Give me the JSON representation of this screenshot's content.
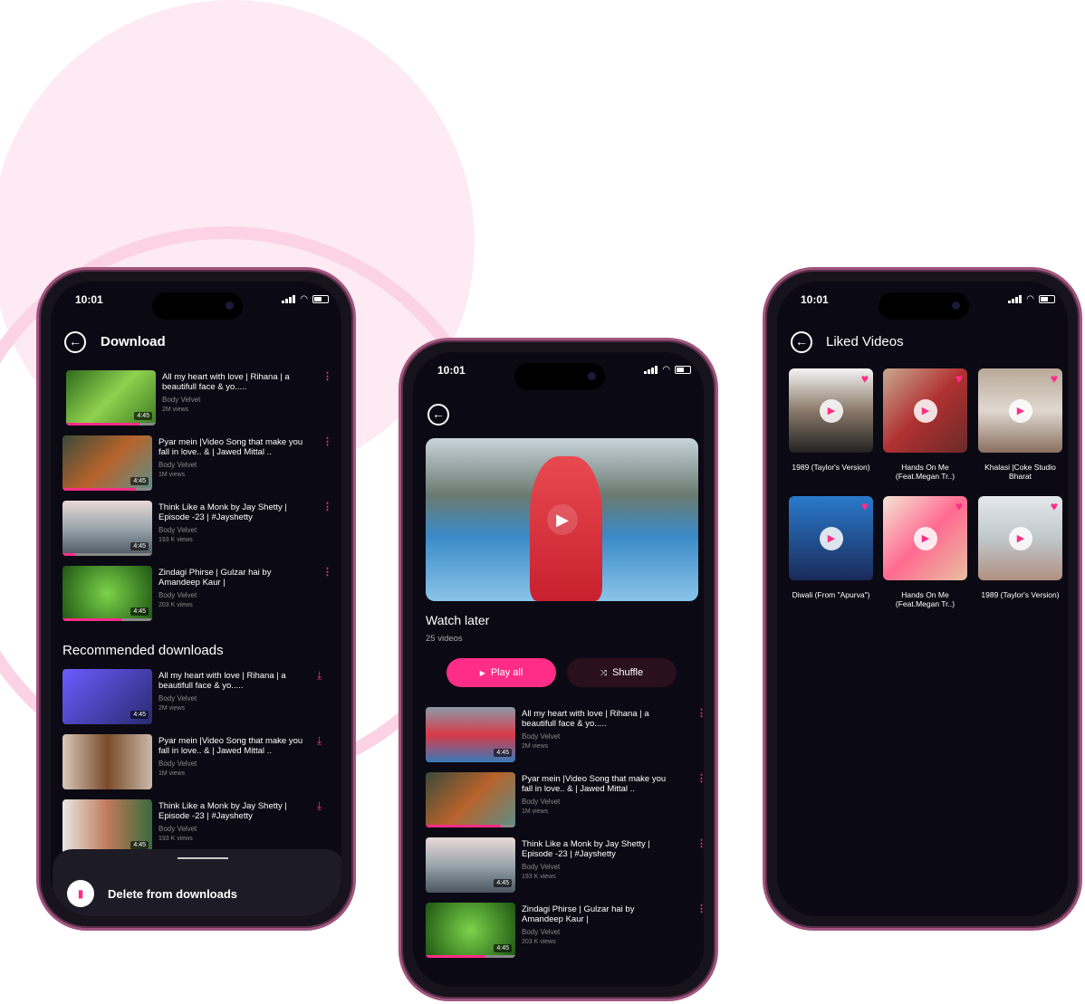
{
  "status": {
    "time": "10:01"
  },
  "colors": {
    "accent": "#ff2d87",
    "screen_bg": "#0b0a14",
    "bg_circle": "#fdeaf2"
  },
  "download": {
    "title": "Download",
    "items": [
      {
        "title": "All my heart with love | Rihana | a beautifull face & yo.....",
        "channel": "Body Velvet",
        "views": "2M views",
        "duration": "4:45",
        "progress": 0.82,
        "thumb": "linear-gradient(135deg,#2f6b1c,#8fd14f,#3c7a22)"
      },
      {
        "title": "Pyar mein |Video Song that make you fall in love.. & | Jawed Mittal ..",
        "channel": "Body Velvet",
        "views": "1M views",
        "duration": "4:45",
        "progress": 0.82,
        "thumb": "linear-gradient(135deg,#3a4a3a,#b8632b,#5d8f88)"
      },
      {
        "title": "Think Like a Monk by Jay Shetty | Episode -23 | #Jayshetty",
        "channel": "Body Velvet",
        "views": "193 K views",
        "duration": "4:45",
        "progress": 0.14,
        "thumb": "linear-gradient(180deg,#e9d9d6,#9aa6ad,#4a5660)"
      },
      {
        "title": "Zindagi Phirse | Gulzar hai by Amandeep Kaur |",
        "channel": "Body Velvet",
        "views": "203 K views",
        "duration": "4:45",
        "progress": 0.67,
        "thumb": "radial-gradient(circle,#7bd34a,#1e5512)"
      }
    ],
    "recommended_heading": "Recommended downloads",
    "recommended": [
      {
        "title": "All my heart with love | Rihana | a beautifull face & yo.....",
        "channel": "Body Velvet",
        "views": "2M views",
        "duration": "4:45",
        "progress": 0,
        "thumb": "linear-gradient(135deg,#6a5cff,#2a2a70)"
      },
      {
        "title": "Pyar mein |Video Song that make you fall in love.. & | Jawed Mittal ..",
        "channel": "Body Velvet",
        "views": "1M views",
        "duration": "",
        "progress": 0,
        "thumb": "linear-gradient(90deg,#d8c8b8,#7a4a2a,#c9b9a9)"
      },
      {
        "title": "Think Like a Monk by Jay Shetty | Episode -23 | #Jayshetty",
        "channel": "Body Velvet",
        "views": "193 K views",
        "duration": "4:45",
        "progress": 0,
        "thumb": "linear-gradient(90deg,#e8e8e8,#c07a5a,#3a6a3a)"
      }
    ],
    "sheet_action": "Delete from downloads"
  },
  "watch_later": {
    "title": "Watch later",
    "count": "25 videos",
    "play_all": "Play all",
    "shuffle": "Shuffle",
    "items": [
      {
        "title": "All my heart with love | Rihana | a beautifull face & yo.....",
        "channel": "Body Velvet",
        "views": "2M views",
        "duration": "4:45",
        "progress": 0,
        "thumb": "linear-gradient(180deg,#8a9aa8,#d83a4a,#3a7ab8)"
      },
      {
        "title": "Pyar mein |Video Song that make you fall in love.. & | Jawed Mittal ..",
        "channel": "Body Velvet",
        "views": "1M views",
        "duration": "",
        "progress": 0.84,
        "thumb": "linear-gradient(135deg,#3a4a3a,#b8632b,#5d8f88)"
      },
      {
        "title": "Think Like a Monk by Jay Shetty | Episode -23 | #Jayshetty",
        "channel": "Body Velvet",
        "views": "193 K views",
        "duration": "4:45",
        "progress": 0,
        "thumb": "linear-gradient(180deg,#e9d9d6,#9aa6ad,#4a5660)"
      },
      {
        "title": "Zindagi Phirse | Gulzar hai by Amandeep Kaur |",
        "channel": "Body Velvet",
        "views": "203 K views",
        "duration": "4:45",
        "progress": 0.67,
        "thumb": "radial-gradient(circle,#7bd34a,#1e5512)"
      }
    ]
  },
  "liked": {
    "title": "Liked Videos",
    "items": [
      {
        "label": "1989 (Taylor's Version)",
        "thumb": "linear-gradient(180deg,#f4f4f4,#8a7a6a,#222)"
      },
      {
        "label": "Hands On Me (Feat.Megan Tr..)",
        "thumb": "linear-gradient(135deg,#c9a890,#b03030,#6a2a2a)"
      },
      {
        "label": "Khalasi |Coke Studio Bharat",
        "thumb": "linear-gradient(180deg,#b8a898,#e0d8d0,#8a7060)"
      },
      {
        "label": "Diwali (From \"Apurva\")",
        "thumb": "linear-gradient(180deg,#2a7acc,#1a2a5a)"
      },
      {
        "label": "Hands On Me (Feat.Megan Tr..)",
        "thumb": "linear-gradient(135deg,#f4e4d4,#ff6a90,#e8c0a0)"
      },
      {
        "label": "1989 (Taylor's Version)",
        "thumb": "linear-gradient(180deg,#e4e8ec,#c0c8cc,#b09080)"
      }
    ]
  }
}
